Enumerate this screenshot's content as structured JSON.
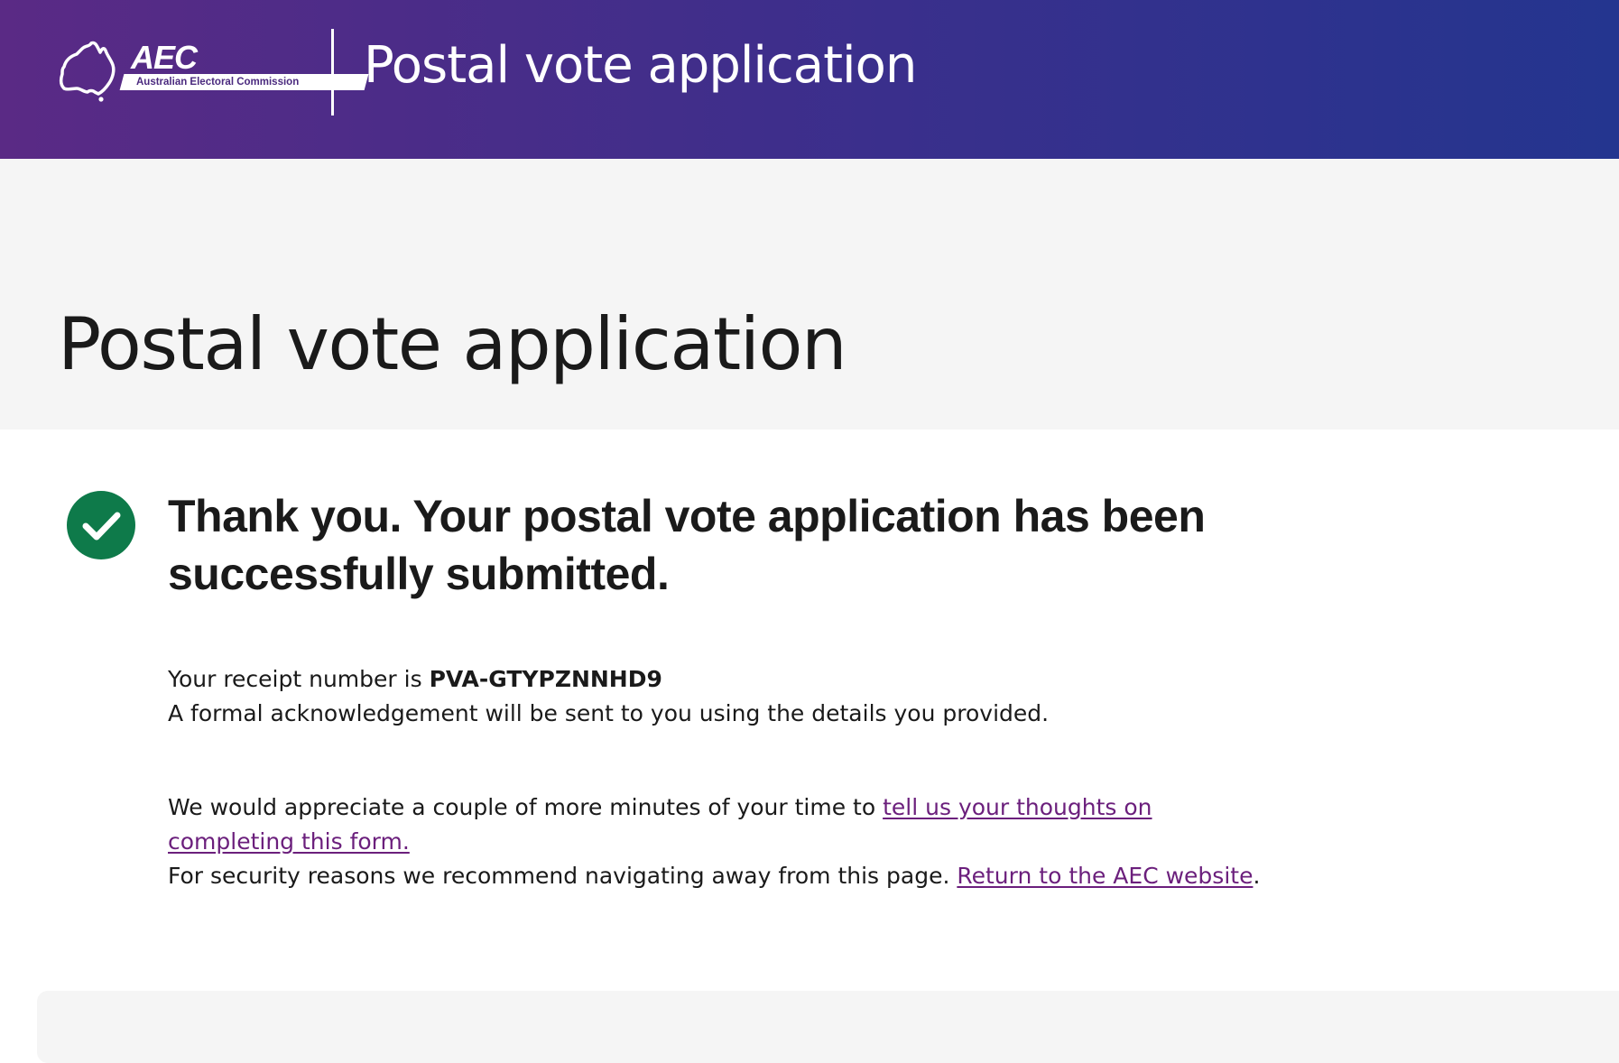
{
  "header": {
    "logo": {
      "acronym": "AEC",
      "subtitle": "Australian Electoral Commission"
    },
    "title": "Postal vote application",
    "gradient": [
      "#5a2a85",
      "#24358f"
    ]
  },
  "hero": {
    "title": "Postal vote application"
  },
  "confirmation": {
    "icon": "check-circle-icon",
    "icon_color": "#0e7a4a",
    "heading": "Thank you. Your postal vote application has been successfully submitted.",
    "receipt_prefix": "Your receipt number is ",
    "receipt_number": "PVA-GTYPZNNHD9",
    "acknowledgement": "A formal acknowledgement will be sent to you using the details you provided.",
    "feedback_prefix": "We would appreciate a couple of more minutes of your time to ",
    "feedback_link": "tell us your thoughts on completing this form.",
    "security_prefix": "For security reasons we recommend navigating away from this page. ",
    "return_link": "Return to the AEC website",
    "security_suffix": "."
  },
  "colors": {
    "link": "#6b1f7c",
    "success": "#0e7a4a",
    "hero_background": "#f5f5f5"
  }
}
